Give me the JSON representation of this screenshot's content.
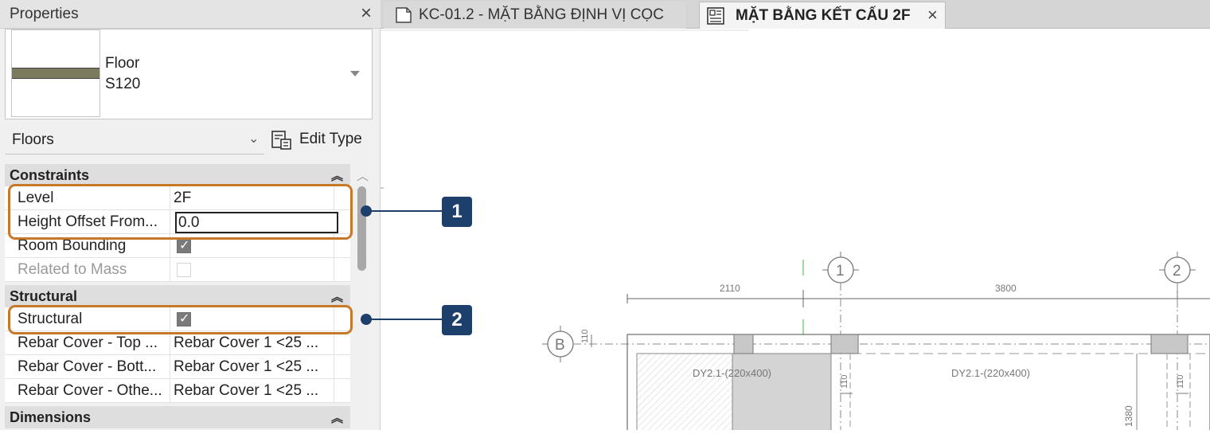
{
  "properties": {
    "title": "Properties",
    "type_name_line1": "Floor",
    "type_name_line2": "S120",
    "category": "Floors",
    "edit_type_label": "Edit Type",
    "sections": {
      "constraints": "Constraints",
      "structural": "Structural",
      "dimensions": "Dimensions"
    },
    "rows": {
      "level_label": "Level",
      "level_value": "2F",
      "height_offset_label": "Height Offset From...",
      "height_offset_value": "0.0",
      "room_bounding_label": "Room Bounding",
      "room_bounding_checked": true,
      "related_to_mass_label": "Related to Mass",
      "related_to_mass_checked": false,
      "structural_label": "Structural",
      "structural_checked": true,
      "rebar_top_label": "Rebar Cover - Top ...",
      "rebar_top_value": "Rebar Cover 1 <25 ...",
      "rebar_bottom_label": "Rebar Cover - Bott...",
      "rebar_bottom_value": "Rebar Cover 1 <25 ...",
      "rebar_other_label": "Rebar Cover - Othe...",
      "rebar_other_value": "Rebar Cover 1 <25 ..."
    }
  },
  "tabs": [
    {
      "label": "KC-01.2 - MẶT BẰNG ĐỊNH VỊ CỌC",
      "active": false
    },
    {
      "label": "MẶT BẰNG KẾT CẤU 2F",
      "active": true
    }
  ],
  "drawing": {
    "grid_1": "1",
    "grid_2": "2",
    "grid_b": "B",
    "dim_left": "2110",
    "dim_right": "3800",
    "beam_left": "DY2.1-(220x400)",
    "beam_right": "DY2.1-(220x400)",
    "dim_110_a": "110",
    "dim_110_b": "110",
    "dim_110_c": "110",
    "dim_1380": "1380"
  },
  "callouts": [
    "1",
    "2"
  ],
  "colors": {
    "highlight": "#c8782a",
    "callout": "#1d3f6b"
  }
}
